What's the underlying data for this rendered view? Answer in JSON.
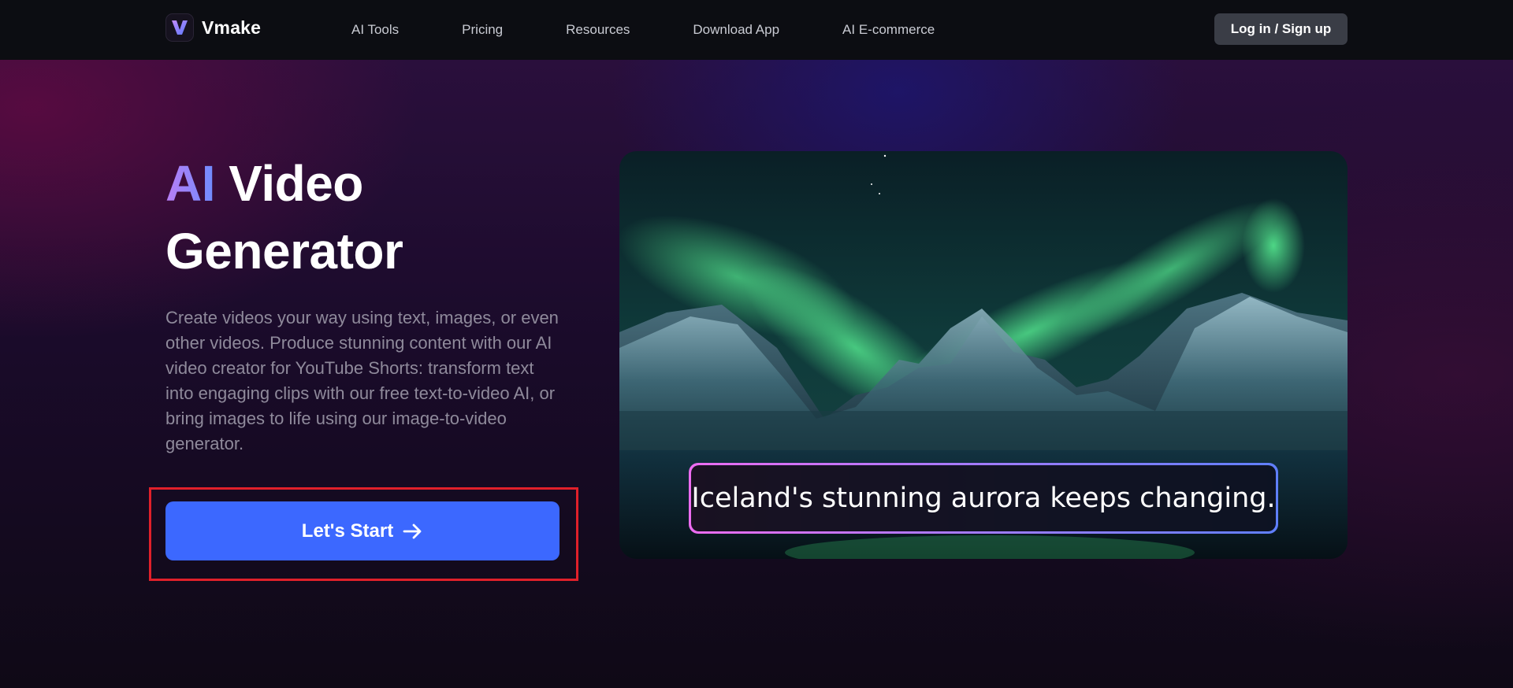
{
  "header": {
    "brand": "Vmake",
    "nav": [
      "AI Tools",
      "Pricing",
      "Resources",
      "Download App",
      "AI E-commerce"
    ],
    "login_label": "Log in / Sign up"
  },
  "hero": {
    "title_accent": "AI",
    "title_rest_line1": "Video",
    "title_line2": "Generator",
    "description": "Create videos your way using text, images, or even other videos. Produce stunning content with our AI video creator for YouTube Shorts: transform text into engaging clips with our free text-to-video AI, or bring images to life using our image-to-video generator.",
    "cta_label": "Let's Start",
    "cta_icon": "arrow-right-icon",
    "caption": "Iceland's stunning aurora keeps changing."
  },
  "colors": {
    "cta": "#3c68ff",
    "highlight": "#e0202a",
    "nav_bg": "#0c0d12"
  }
}
